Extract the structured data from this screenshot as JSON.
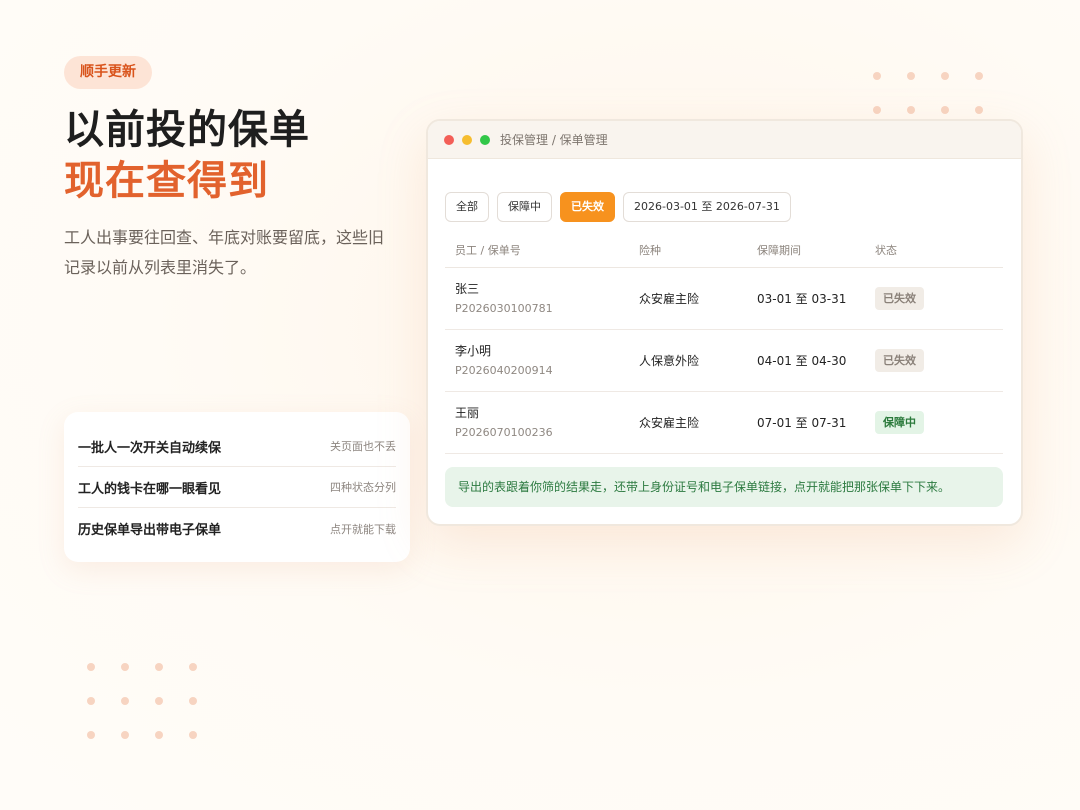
{
  "hero": {
    "badge": "顺手更新",
    "title_line1": "以前投的保单",
    "title_line2": "现在查得到",
    "description": "工人出事要往回查、年底对账要留底，这些旧记录以前从列表里消失了。"
  },
  "features": [
    {
      "title": "一批人一次开关自动续保",
      "note": "关页面也不丢"
    },
    {
      "title": "工人的钱卡在哪一眼看见",
      "note": "四种状态分列"
    },
    {
      "title": "历史保单导出带电子保单",
      "note": "点开就能下载"
    }
  ],
  "window": {
    "breadcrumb": "投保管理 / 保单管理",
    "filters": [
      {
        "label": "全部",
        "active": false
      },
      {
        "label": "保障中",
        "active": false
      },
      {
        "label": "已失效",
        "active": true
      }
    ],
    "date_range": "2026-03-01 至 2026-07-31",
    "columns": [
      "员工 / 保单号",
      "险种",
      "保障期间",
      "状态"
    ],
    "rows": [
      {
        "name": "张三",
        "policy_no": "P2026030100781",
        "type": "众安雇主险",
        "period": "03-01 至 03-31",
        "status": "已失效",
        "status_kind": "expired"
      },
      {
        "name": "李小明",
        "policy_no": "P2026040200914",
        "type": "人保意外险",
        "period": "04-01 至 04-30",
        "status": "已失效",
        "status_kind": "expired"
      },
      {
        "name": "王丽",
        "policy_no": "P2026070100236",
        "type": "众安雇主险",
        "period": "07-01 至 07-31",
        "status": "保障中",
        "status_kind": "active"
      }
    ],
    "note": "导出的表跟着你筛的结果走，还带上身份证号和电子保单链接，点开就能把那张保单下下来。"
  },
  "colors": {
    "accent": "#e2622d",
    "active_chip": "#f7921e",
    "status_active": "#2b7a3c",
    "status_expired": "#8a8179"
  }
}
